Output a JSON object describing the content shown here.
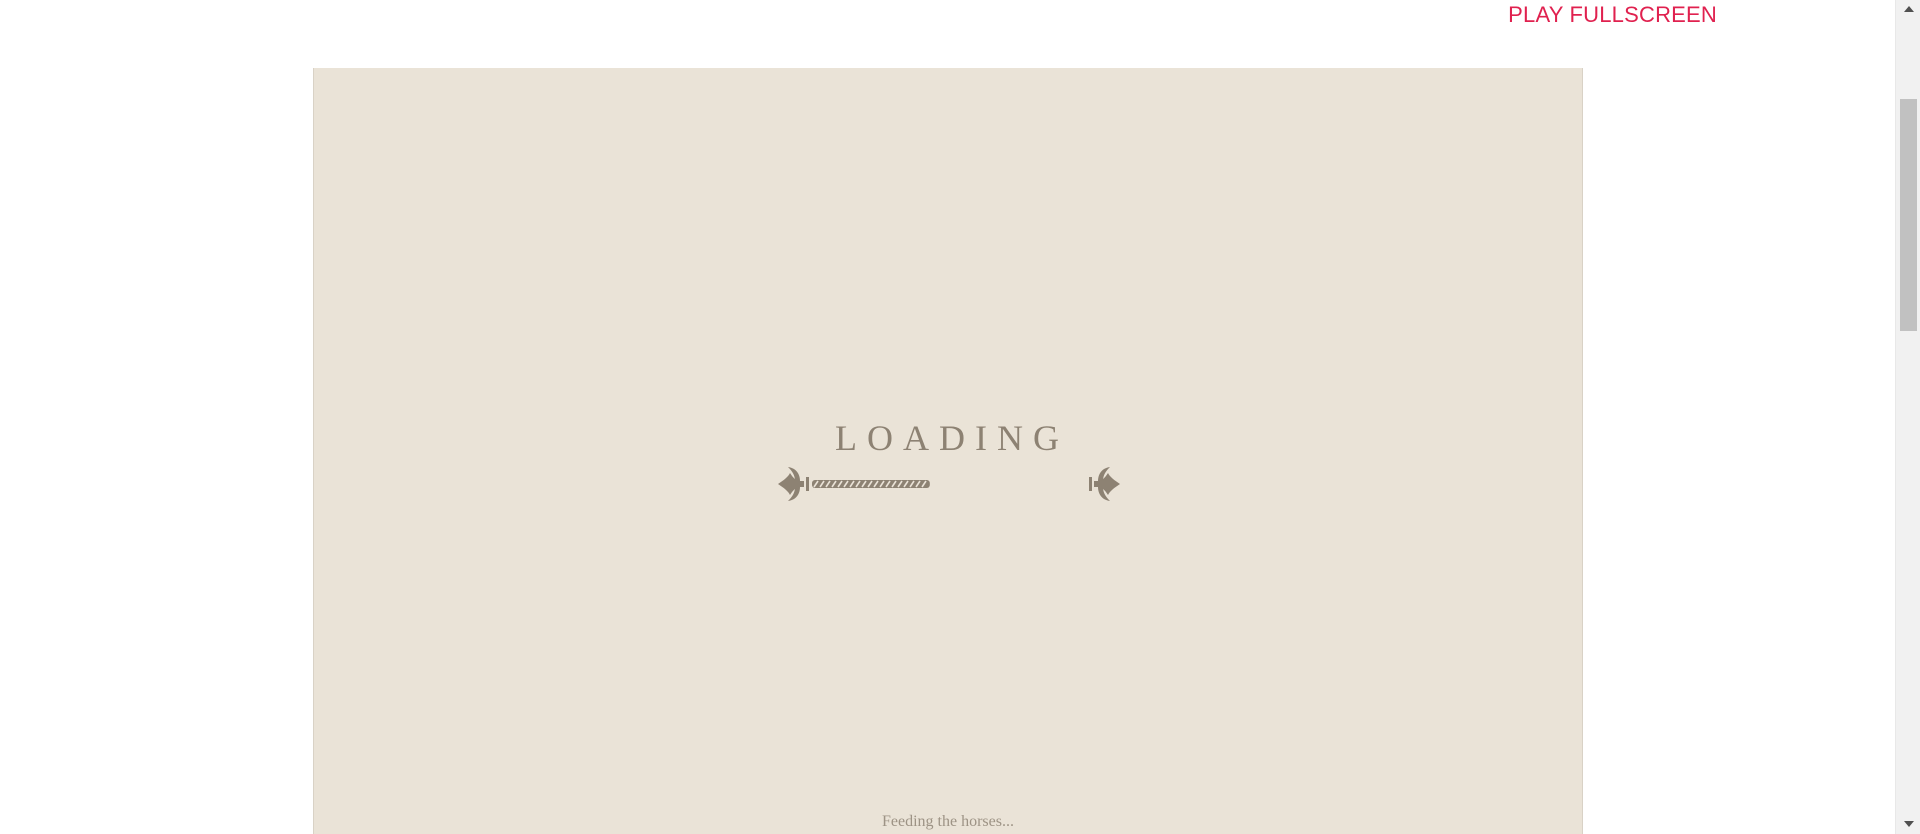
{
  "header": {
    "play_fullscreen_label": "PLAY FULLSCREEN"
  },
  "game": {
    "loading_title": "LOADING",
    "loading_progress": 0.43,
    "status_message": "Feeding the horses..."
  },
  "colors": {
    "link": "#e0214f",
    "game_background": "#eae3d7",
    "ornament": "#8d8273"
  },
  "scrollbar": {
    "up_icon": "triangle-up-icon",
    "down_icon": "triangle-down-icon"
  }
}
